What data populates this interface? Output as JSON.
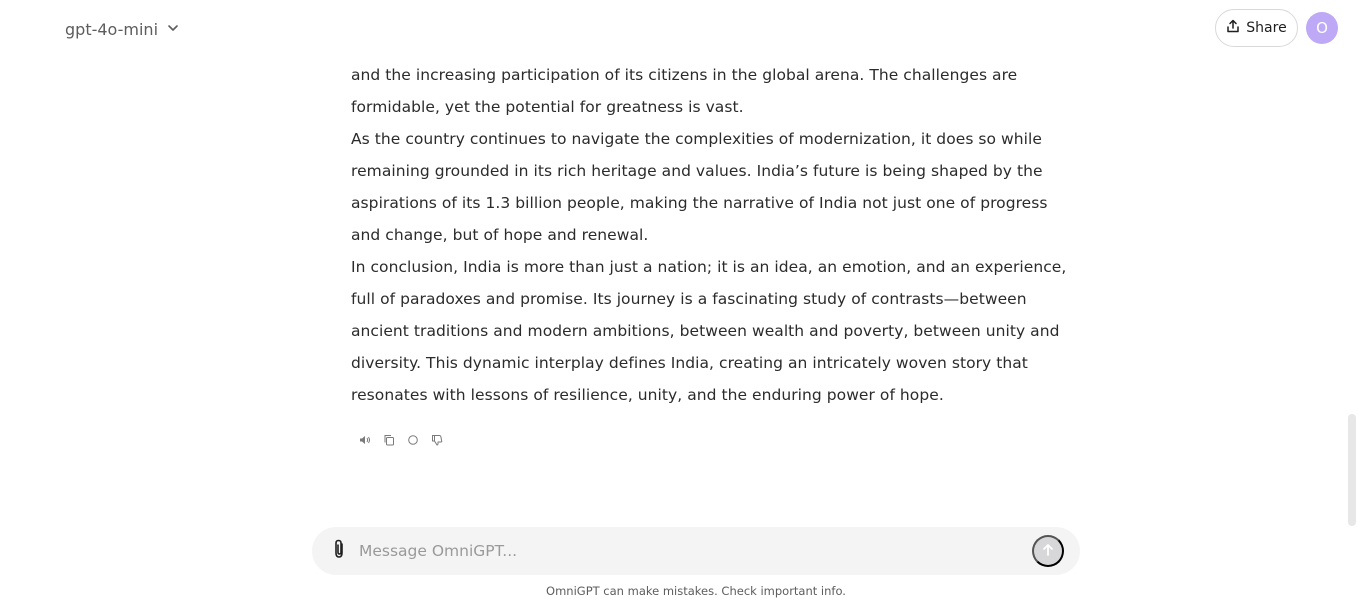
{
  "header": {
    "model_name": "gpt-4o-mini",
    "share_label": "Share",
    "avatar_initial": "O"
  },
  "message": {
    "paragraphs": [
      "and the increasing participation of its citizens in the global arena. The challenges are formidable, yet the potential for greatness is vast.",
      "As the country continues to navigate the complexities of modernization, it does so while remaining grounded in its rich heritage and values. India’s future is being shaped by the aspirations of its 1.3 billion people, making the narrative of India not just one of progress and change, but of hope and renewal.",
      "In conclusion, India is more than just a nation; it is an idea, an emotion, and an experience, full of paradoxes and promise. Its journey is a fascinating study of contrasts—between ancient traditions and modern ambitions, between wealth and poverty, between unity and diversity. This dynamic interplay defines India, creating an intricately woven story that resonates with lessons of resilience, unity, and the enduring power of hope."
    ],
    "actions": [
      {
        "icon": "speaker-icon"
      },
      {
        "icon": "copy-icon"
      },
      {
        "icon": "regenerate-icon"
      },
      {
        "icon": "thumbs-down-icon"
      }
    ]
  },
  "composer": {
    "placeholder": "Message OmniGPT...",
    "value": ""
  },
  "footer": {
    "disclaimer": "OmniGPT can make mistakes. Check important info."
  },
  "colors": {
    "avatar_bg": "#bda9f5",
    "composer_bg": "#f4f4f5",
    "send_button_bg": "#d7d7d9"
  }
}
